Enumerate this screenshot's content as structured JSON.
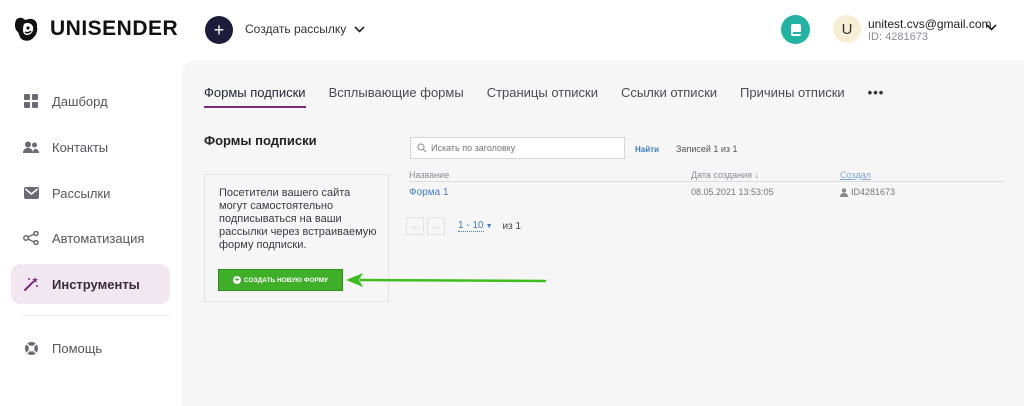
{
  "header": {
    "logo_text": "UNISENDER",
    "create_button_symbol": "+",
    "create_campaign_label": "Создать рассылку",
    "user": {
      "avatar_letter": "U",
      "email": "unitest.cvs@gmail.com",
      "id": "ID: 4281673"
    }
  },
  "sidebar": {
    "items": [
      {
        "label": "Дашборд",
        "icon": "dashboard-icon"
      },
      {
        "label": "Контакты",
        "icon": "contacts-icon"
      },
      {
        "label": "Рассылки",
        "icon": "mail-icon"
      },
      {
        "label": "Автоматизация",
        "icon": "automation-icon"
      },
      {
        "label": "Инструменты",
        "icon": "magic-wand-icon",
        "active": true
      },
      {
        "label": "Помощь",
        "icon": "help-lifebuoy-icon"
      }
    ]
  },
  "tabs": [
    {
      "label": "Формы подписки",
      "active": true
    },
    {
      "label": "Всплывающие формы"
    },
    {
      "label": "Страницы отписки"
    },
    {
      "label": "Ссылки отписки"
    },
    {
      "label": "Причины отписки"
    }
  ],
  "tabs_more": "•••",
  "main": {
    "title": "Формы подписки",
    "info_text": "Посетители вашего сайта могут самостоятельно подписываться на ваши рассылки через встраиваемую форму подписки.",
    "new_form_button": "СОЗДАТЬ НОВУЮ ФОРМУ",
    "search_placeholder": "Искать по заголовку",
    "find_button": "Найти",
    "records_text": "Записей 1 из 1",
    "table": {
      "headers": [
        "Название",
        "Дата создания ↓",
        "Создал"
      ],
      "rows": [
        [
          "Форма 1",
          "08.05.2021 13:53:05",
          "ID4281673"
        ]
      ]
    },
    "pagination": {
      "range": "1 - 10",
      "of": "из 1"
    }
  },
  "colors": {
    "accent": "#7d2a7a",
    "green_button": "#3fae29",
    "arrow": "#3fbf1f",
    "link": "#3d7fc1",
    "help_button": "#22b3a3"
  }
}
